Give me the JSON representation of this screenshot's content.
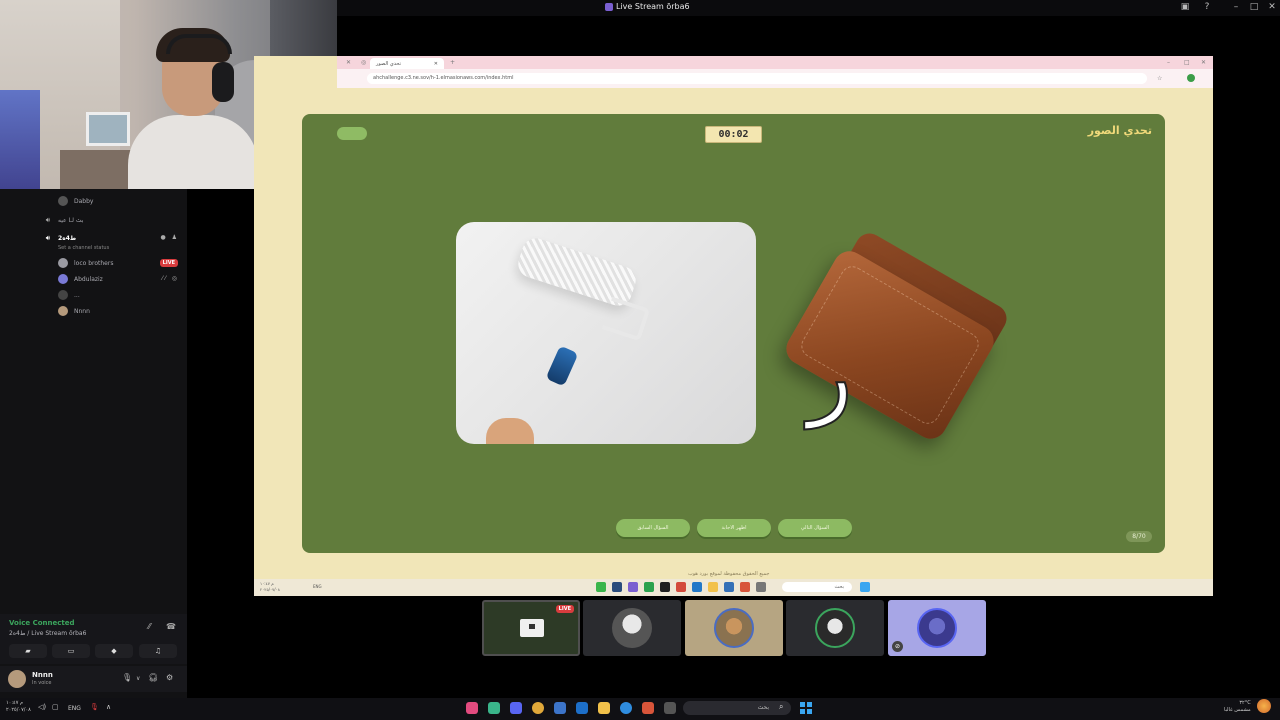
{
  "window": {
    "title": "Live Stream ōrba6"
  },
  "sidebar": {
    "rows": [
      {
        "label": "Dabby",
        "type": "user"
      },
      {
        "label": "بث لـا عيه",
        "type": "channel"
      },
      {
        "label": "2ط4ه",
        "type": "channel-active",
        "sub": "Set a channel status"
      },
      {
        "label": "loco brothers",
        "type": "user",
        "badge": "LIVE"
      },
      {
        "label": "Abdulaziz",
        "type": "user"
      },
      {
        "label": "...",
        "type": "user"
      },
      {
        "label": "Nnnn",
        "type": "user"
      }
    ]
  },
  "voice": {
    "status": "Voice Connected",
    "channel": "2ط4ه / Live Stream ōrba6"
  },
  "user": {
    "name": "Nnnn",
    "status": "In voice"
  },
  "browser": {
    "tab_label": "تحدي الصور",
    "url": "ahchallenge.c3.ne.sov/h-1.elmasionaws.com/index.html"
  },
  "game": {
    "title": "تحدي الصور",
    "timer": "00:02",
    "corner_button": "",
    "answer_letter": "ر",
    "buttons": [
      "السؤال السابق",
      "اظهر الاجابة",
      "السؤال التالي"
    ],
    "counter": "8/70",
    "footer": "جميع الحقوق محفوظة لموقع بورد هوب"
  },
  "participants": {
    "live_badge": "LIVE"
  },
  "taskbar": {
    "clock_time": "م ١٠:٤٧",
    "clock_date": "٢٠٢٥/٠٧/٠٨",
    "lang": "ENG",
    "search_placeholder": "بحث",
    "weather_temp": "٣٢°C",
    "weather_desc": "مشمس غالبا"
  },
  "colors": {
    "game_bg": "#617c3c",
    "page_bg": "#f1e6b8",
    "accent_green": "#8dba62",
    "live_red": "#d83c3e",
    "voice_green": "#3ba55d"
  }
}
